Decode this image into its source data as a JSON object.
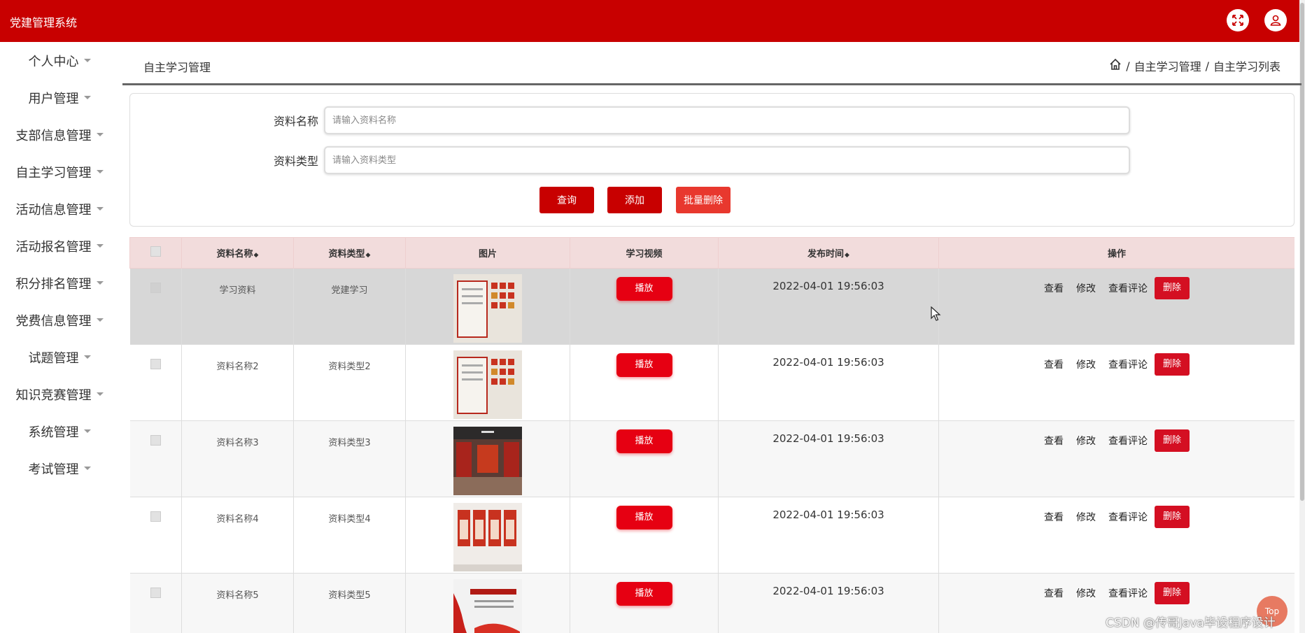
{
  "app": {
    "title": "党建管理系统"
  },
  "sidebar": {
    "items": [
      {
        "label": "个人中心"
      },
      {
        "label": "用户管理"
      },
      {
        "label": "支部信息管理"
      },
      {
        "label": "自主学习管理"
      },
      {
        "label": "活动信息管理"
      },
      {
        "label": "活动报名管理"
      },
      {
        "label": "积分排名管理"
      },
      {
        "label": "党费信息管理"
      },
      {
        "label": "试题管理"
      },
      {
        "label": "知识竞赛管理"
      },
      {
        "label": "系统管理"
      },
      {
        "label": "考试管理"
      }
    ]
  },
  "header": {
    "page_title": "自主学习管理",
    "breadcrumb": [
      "自主学习管理",
      "自主学习列表"
    ],
    "separator": "/"
  },
  "search": {
    "name_label": "资料名称",
    "name_placeholder": "请输入资料名称",
    "type_label": "资料类型",
    "type_placeholder": "请输入资料类型",
    "query_label": "查询",
    "add_label": "添加",
    "batch_delete_label": "批量删除"
  },
  "table": {
    "columns": {
      "name": "资料名称",
      "type": "资料类型",
      "image": "图片",
      "video": "学习视频",
      "time": "发布时间",
      "ops": "操作"
    },
    "rows": [
      {
        "name": "学习资料",
        "type": "党建学习",
        "play": "播放",
        "time": "2022-04-01 19:56:03"
      },
      {
        "name": "资料名称2",
        "type": "资料类型2",
        "play": "播放",
        "time": "2022-04-01 19:56:03"
      },
      {
        "name": "资料名称3",
        "type": "资料类型3",
        "play": "播放",
        "time": "2022-04-01 19:56:03"
      },
      {
        "name": "资料名称4",
        "type": "资料类型4",
        "play": "播放",
        "time": "2022-04-01 19:56:03"
      },
      {
        "name": "资料名称5",
        "type": "资料类型5",
        "play": "播放",
        "time": "2022-04-01 19:56:03"
      }
    ],
    "actions": {
      "view": "查看",
      "edit": "修改",
      "comments": "查看评论",
      "delete": "删除"
    }
  },
  "watermark": "CSDN @传哥Java毕设程序设计",
  "top_button": "Top",
  "colors": {
    "primary": "#c80000",
    "header_bg": "#f2dcdc",
    "delete": "#d40f22",
    "play": "#e60012"
  }
}
